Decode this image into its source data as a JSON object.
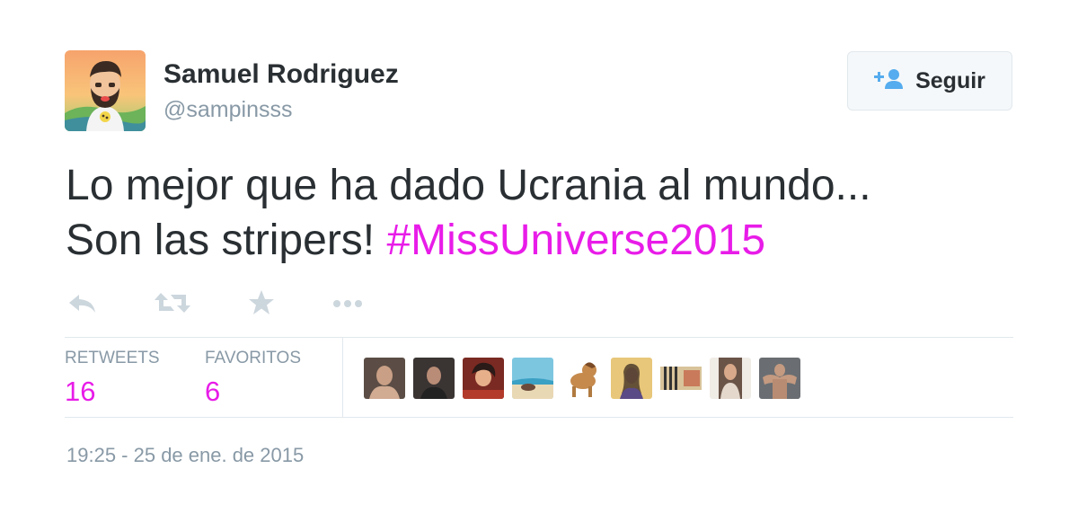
{
  "user": {
    "name": "Samuel Rodriguez",
    "handle": "@sampinsss"
  },
  "follow_button": {
    "label": "Seguir",
    "icon": "add-user-icon"
  },
  "tweet": {
    "text_line1": "Lo mejor que ha dado Ucrania al mundo...",
    "text_line2_prefix": "Son las stripers!",
    "hashtag": "#MissUniverse2015",
    "hashtag_color": "#e81ce8"
  },
  "actions": {
    "icons": [
      "reply-icon",
      "retweet-icon",
      "favorite-star-icon",
      "more-options-icon"
    ]
  },
  "stats": {
    "retweets_label": "RETWEETS",
    "retweets_value": "16",
    "favorites_label": "FAVORITOS",
    "favorites_value": "6"
  },
  "favoriters_count_shown": 9,
  "timestamp": "19:25 - 25 de ene. de 2015",
  "colors": {
    "text": "#292f33",
    "muted": "#8899a6",
    "accent": "#e81ce8",
    "border": "#e1e8ed",
    "button_bg": "#f5f8fa"
  }
}
